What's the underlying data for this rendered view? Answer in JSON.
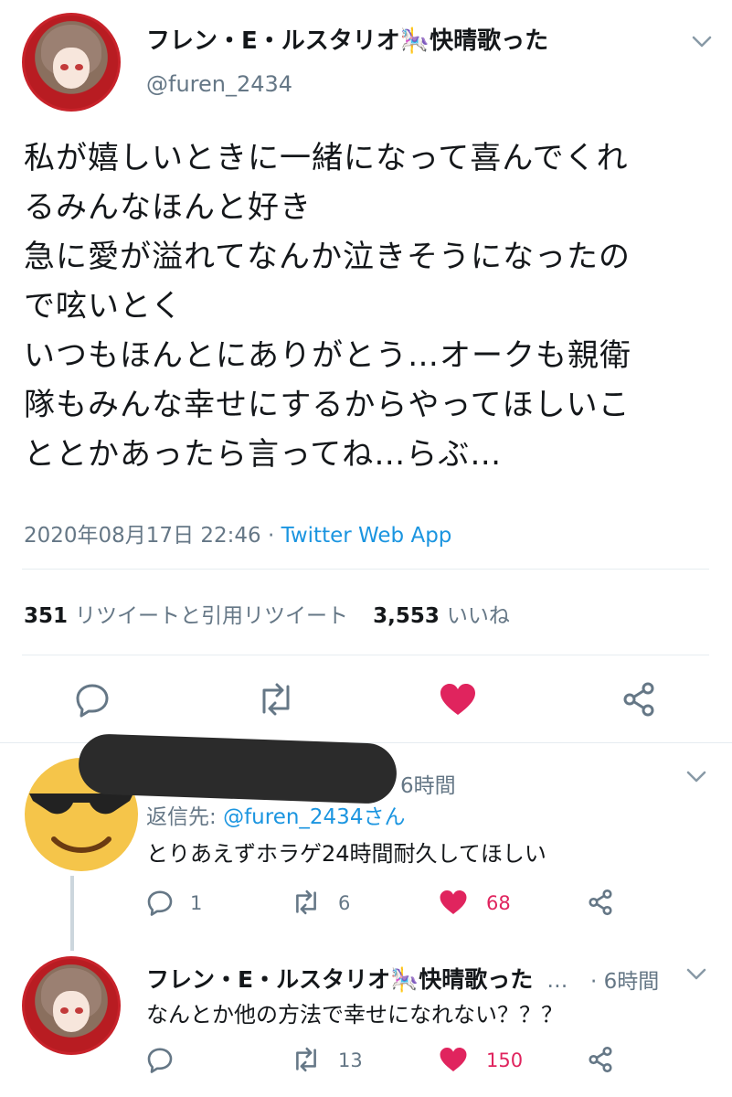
{
  "main_tweet": {
    "author_name": "フレン・E・ルスタリオ🎠快晴歌った",
    "author_handle": "@furen_2434",
    "text_lines": [
      "私が嬉しいときに一緒になって喜んでくれ",
      "るみんなほんと好き",
      "急に愛が溢れてなんか泣きそうになったの",
      "で呟いとく",
      "いつもほんとにありがとう…オークも親衛",
      "隊もみんな幸せにするからやってほしいこ",
      "ととかあったら言ってね…らぶ…"
    ],
    "timestamp": "2020年08月17日 22:46",
    "separator": " · ",
    "via": "Twitter Web App",
    "retweets_count": "351",
    "retweets_label": "リツイートと引用リツイート",
    "likes_count": "3,553",
    "likes_label": "いいね"
  },
  "reply1": {
    "time": "6時間",
    "replying_prefix": "返信先: ",
    "replying_mention": "@furen_2434さん",
    "text": "とりあえずホラゲ24時間耐久してほしい",
    "replies": "1",
    "retweets": "6",
    "likes": "68"
  },
  "reply2": {
    "author_name": "フレン・E・ルスタリオ🎠快晴歌った",
    "ellipsis": "…",
    "time": "· 6時間",
    "text": "なんとか他の方法で幸せになれない？？？",
    "replies": "",
    "retweets": "13",
    "likes": "150"
  },
  "colors": {
    "like_active": "#e0245e",
    "link": "#1b95e0",
    "secondary_text": "#657786"
  },
  "icons": [
    "reply-icon",
    "retweet-icon",
    "like-icon",
    "share-icon",
    "chevron-down-icon",
    "sunglasses-emoji-icon"
  ]
}
